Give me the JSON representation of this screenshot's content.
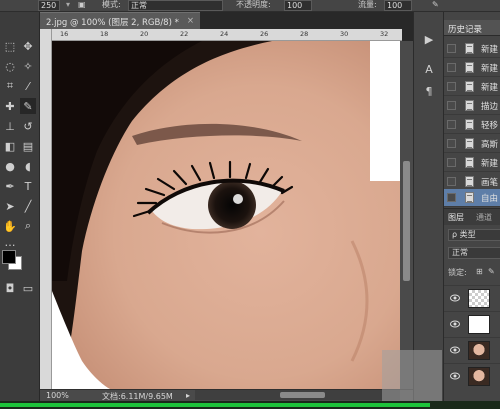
{
  "options_bar": {
    "brush_size": "250",
    "mode_label": "模式:",
    "mode_value": "正常",
    "opacity_label": "不透明度:",
    "opacity_value": "100 %",
    "flow_label": "流量:",
    "flow_value": "100 %"
  },
  "document": {
    "tab_title": "2.jpg @ 100% (图层 2, RGB/8) *",
    "tab_close": "×",
    "ruler_ticks": [
      "16",
      "18",
      "20",
      "22",
      "24",
      "26",
      "28",
      "30",
      "32"
    ],
    "zoom": "100%",
    "doc_size": "文档:6.11M/9.65M",
    "status_arrow": "▸"
  },
  "history_panel": {
    "title": "历史记录",
    "items": [
      {
        "label": "新建",
        "active": false
      },
      {
        "label": "新建",
        "active": false
      },
      {
        "label": "新建",
        "active": false
      },
      {
        "label": "描边",
        "active": false
      },
      {
        "label": "轻移",
        "active": false
      },
      {
        "label": "高斯",
        "active": false
      },
      {
        "label": "新建",
        "active": false
      },
      {
        "label": "画笔",
        "active": false
      },
      {
        "label": "自由",
        "active": true
      }
    ]
  },
  "layers_panel": {
    "tab_layers": "图层",
    "tab_channels": "通道",
    "filter_label": "ρ 类型",
    "blend_mode": "正常",
    "lock_label": "锁定:",
    "layers": [
      {
        "thumb": "transparent"
      },
      {
        "thumb": "white"
      },
      {
        "thumb": "face"
      },
      {
        "thumb": "face"
      }
    ]
  },
  "taskbar": {
    "progress": 0.86,
    "color": "#1cc43a"
  },
  "colors": {
    "foreground": "#000000",
    "background": "#ffffff",
    "active_row": "#5e7ea8"
  }
}
